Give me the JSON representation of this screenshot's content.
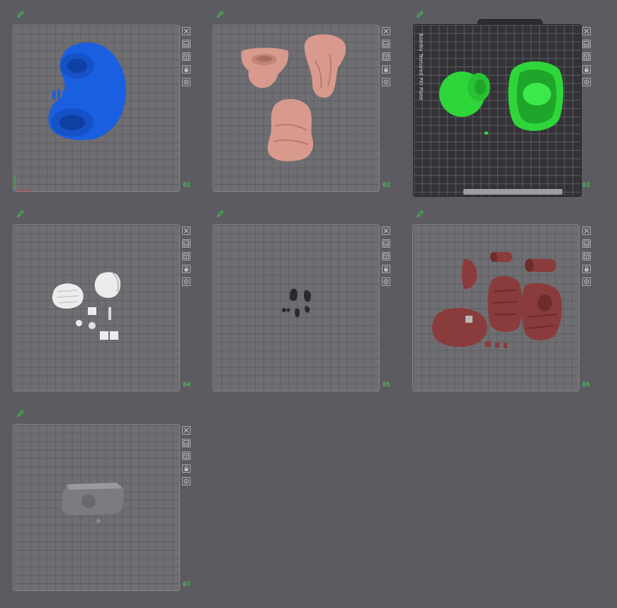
{
  "plates": [
    {
      "number": "01",
      "model": "blue-character-part"
    },
    {
      "number": "02",
      "model": "skin-body-parts"
    },
    {
      "number": "03",
      "model": "green-parts",
      "plate_label": "Bambu Textured PEI Plate"
    },
    {
      "number": "04",
      "model": "white-hands"
    },
    {
      "number": "05",
      "model": "dark-small-parts"
    },
    {
      "number": "06",
      "model": "red-parts"
    },
    {
      "number": "07",
      "model": "gray-block"
    }
  ],
  "plate_tools": [
    "close-icon",
    "image-icon",
    "layout-icon",
    "lock-icon",
    "settings-icon"
  ],
  "colors": {
    "background": "#5c5b61",
    "plate": "#6f6e73",
    "number": "#3cc14a",
    "blue_model": "#1a5fe0",
    "skin_model": "#d99a8e",
    "green_model": "#2ed63a",
    "white_model": "#ececec",
    "dark_model": "#2a2a2e",
    "red_model": "#8a3b3b",
    "gray_model": "#7c7c80"
  }
}
